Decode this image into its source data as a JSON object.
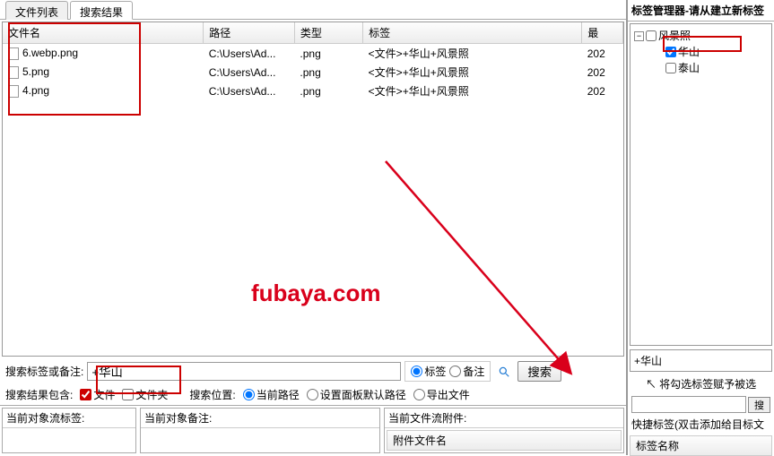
{
  "tabs": {
    "file_list": "文件列表",
    "search_results": "搜索结果"
  },
  "table": {
    "headers": {
      "name": "文件名",
      "path": "路径",
      "type": "类型",
      "tags": "标签",
      "date": "最"
    },
    "rows": [
      {
        "name": "6.webp.png",
        "path": "C:\\Users\\Ad...",
        "type": ".png",
        "tags": "<文件>+华山+风景照",
        "date": "202"
      },
      {
        "name": "5.png",
        "path": "C:\\Users\\Ad...",
        "type": ".png",
        "tags": "<文件>+华山+风景照",
        "date": "202"
      },
      {
        "name": "4.png",
        "path": "C:\\Users\\Ad...",
        "type": ".png",
        "tags": "<文件>+华山+风景照",
        "date": "202"
      }
    ]
  },
  "watermark": "fubaya.com",
  "search": {
    "label": "搜索标签或备注:",
    "value": "+华山",
    "radio_tag": "标签",
    "radio_note": "备注",
    "icon_name": "search-icon",
    "button": "搜索"
  },
  "filter": {
    "contains_label": "搜索结果包含:",
    "file": "文件",
    "folder": "文件夹",
    "location_label": "搜索位置:",
    "current_path": "当前路径",
    "default_path": "设置面板默认路径",
    "export": "导出文件"
  },
  "bottom": {
    "current_obj_tags": "当前对象流标签:",
    "current_obj_note": "当前对象备注:",
    "current_file_attach": "当前文件流附件:",
    "attach_col": "附件文件名"
  },
  "right": {
    "title": "标签管理器-请从建立新标签",
    "tree": {
      "root": "风景照",
      "children": [
        {
          "label": "华山",
          "checked": true
        },
        {
          "label": "泰山",
          "checked": false
        }
      ]
    },
    "plus_tag": "+华山",
    "assign_title": "将勾选标签赋予被选",
    "search_btn_small": "搜",
    "quick_tag_label": "快捷标签(双击添加给目标文",
    "tag_name_header": "标签名称"
  }
}
